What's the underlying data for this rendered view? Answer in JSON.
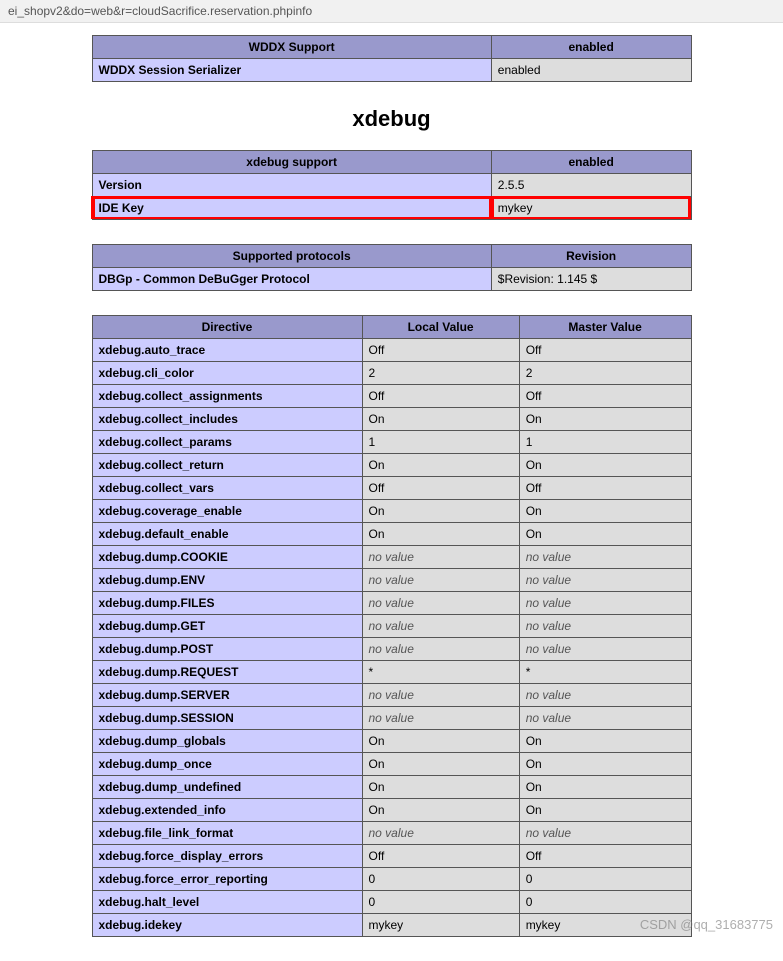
{
  "url_fragment": "ei_shopv2&do=web&r=cloudSacrifice.reservation.phpinfo",
  "wddx": {
    "header": [
      "WDDX Support",
      "enabled"
    ],
    "rows": [
      {
        "name": "WDDX Session Serializer",
        "value": "enabled"
      }
    ]
  },
  "section_title": "xdebug",
  "xdebug_support": {
    "header": [
      "xdebug support",
      "enabled"
    ],
    "rows": [
      {
        "name": "Version",
        "value": "2.5.5",
        "highlight": false
      },
      {
        "name": "IDE Key",
        "value": "mykey",
        "highlight": true
      }
    ]
  },
  "protocols": {
    "header": [
      "Supported protocols",
      "Revision"
    ],
    "rows": [
      {
        "name": "DBGp - Common DeBuGger Protocol",
        "value": "$Revision: 1.145 $"
      }
    ]
  },
  "directives": {
    "header": [
      "Directive",
      "Local Value",
      "Master Value"
    ],
    "rows": [
      {
        "d": "xdebug.auto_trace",
        "l": "Off",
        "m": "Off"
      },
      {
        "d": "xdebug.cli_color",
        "l": "2",
        "m": "2"
      },
      {
        "d": "xdebug.collect_assignments",
        "l": "Off",
        "m": "Off"
      },
      {
        "d": "xdebug.collect_includes",
        "l": "On",
        "m": "On"
      },
      {
        "d": "xdebug.collect_params",
        "l": "1",
        "m": "1"
      },
      {
        "d": "xdebug.collect_return",
        "l": "On",
        "m": "On"
      },
      {
        "d": "xdebug.collect_vars",
        "l": "Off",
        "m": "Off"
      },
      {
        "d": "xdebug.coverage_enable",
        "l": "On",
        "m": "On"
      },
      {
        "d": "xdebug.default_enable",
        "l": "On",
        "m": "On"
      },
      {
        "d": "xdebug.dump.COOKIE",
        "l": "no value",
        "m": "no value",
        "nv": true
      },
      {
        "d": "xdebug.dump.ENV",
        "l": "no value",
        "m": "no value",
        "nv": true
      },
      {
        "d": "xdebug.dump.FILES",
        "l": "no value",
        "m": "no value",
        "nv": true
      },
      {
        "d": "xdebug.dump.GET",
        "l": "no value",
        "m": "no value",
        "nv": true
      },
      {
        "d": "xdebug.dump.POST",
        "l": "no value",
        "m": "no value",
        "nv": true
      },
      {
        "d": "xdebug.dump.REQUEST",
        "l": "*",
        "m": "*"
      },
      {
        "d": "xdebug.dump.SERVER",
        "l": "no value",
        "m": "no value",
        "nv": true
      },
      {
        "d": "xdebug.dump.SESSION",
        "l": "no value",
        "m": "no value",
        "nv": true
      },
      {
        "d": "xdebug.dump_globals",
        "l": "On",
        "m": "On"
      },
      {
        "d": "xdebug.dump_once",
        "l": "On",
        "m": "On"
      },
      {
        "d": "xdebug.dump_undefined",
        "l": "On",
        "m": "On"
      },
      {
        "d": "xdebug.extended_info",
        "l": "On",
        "m": "On"
      },
      {
        "d": "xdebug.file_link_format",
        "l": "no value",
        "m": "no value",
        "nv": true
      },
      {
        "d": "xdebug.force_display_errors",
        "l": "Off",
        "m": "Off"
      },
      {
        "d": "xdebug.force_error_reporting",
        "l": "0",
        "m": "0"
      },
      {
        "d": "xdebug.halt_level",
        "l": "0",
        "m": "0"
      },
      {
        "d": "xdebug.idekey",
        "l": "mykey",
        "m": "mykey"
      }
    ]
  },
  "watermark": "CSDN @qq_31683775"
}
